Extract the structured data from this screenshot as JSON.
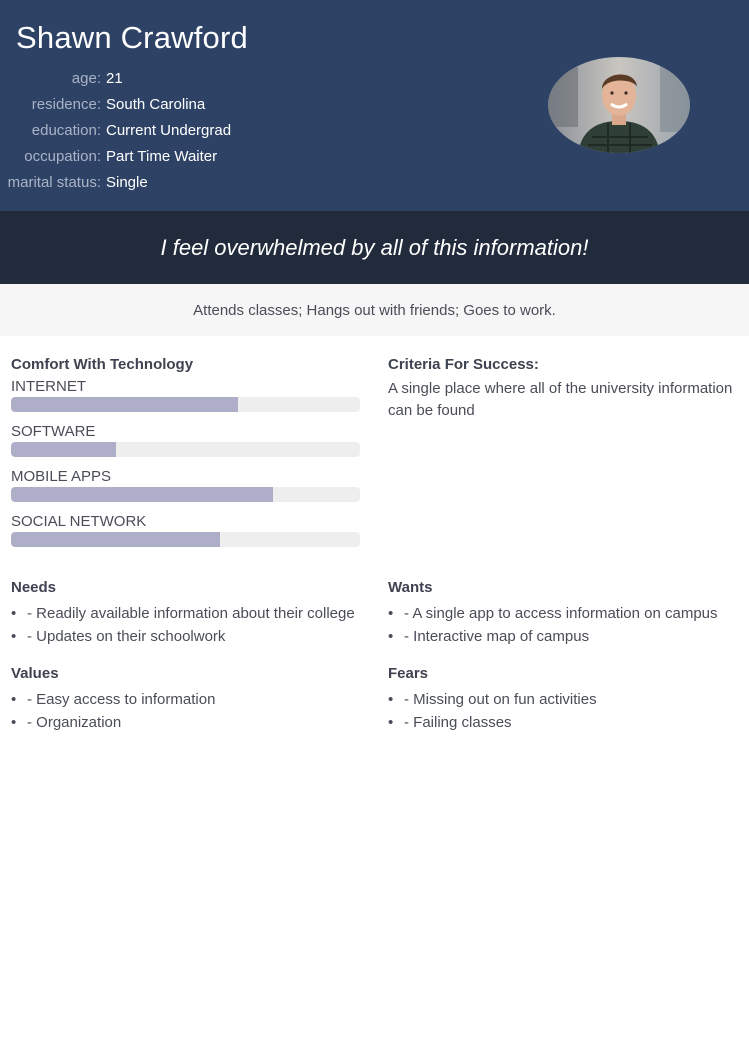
{
  "persona": {
    "name": "Shawn Crawford",
    "info": [
      {
        "label": "age:",
        "value": "21"
      },
      {
        "label": "residence:",
        "value": "South Carolina"
      },
      {
        "label": "education:",
        "value": "Current Undergrad"
      },
      {
        "label": "occupation:",
        "value": "Part Time Waiter"
      },
      {
        "label": "marital status:",
        "value": "Single"
      }
    ],
    "quote": "I feel overwhelmed by all of this information!",
    "activities": "Attends classes; Hangs out with friends; Goes to work."
  },
  "comfort": {
    "title": "Comfort With Technology",
    "skills": [
      {
        "label": "INTERNET",
        "level": 0.65
      },
      {
        "label": "SOFTWARE",
        "level": 0.3
      },
      {
        "label": "MOBILE APPS",
        "level": 0.75
      },
      {
        "label": "SOCIAL NETWORK",
        "level": 0.6
      }
    ]
  },
  "criteria": {
    "title": "Criteria For Success:",
    "text": "A single place where all of the university information can be found"
  },
  "needs": {
    "title": "Needs",
    "items": [
      "- Readily available information about their college",
      "- Updates on their schoolwork"
    ]
  },
  "wants": {
    "title": "Wants",
    "items": [
      "- A single app to access information on campus",
      "- Interactive map of campus"
    ]
  },
  "values": {
    "title": "Values",
    "items": [
      "- Easy access to information",
      "- Organization"
    ]
  },
  "fears": {
    "title": "Fears",
    "items": [
      "- Missing out on fun activities",
      "- Failing classes"
    ]
  },
  "colors": {
    "header": "#2e4266",
    "quote_band": "#222b3b",
    "bar_fill": "#aeaec8",
    "bar_track": "#eeeeee"
  }
}
